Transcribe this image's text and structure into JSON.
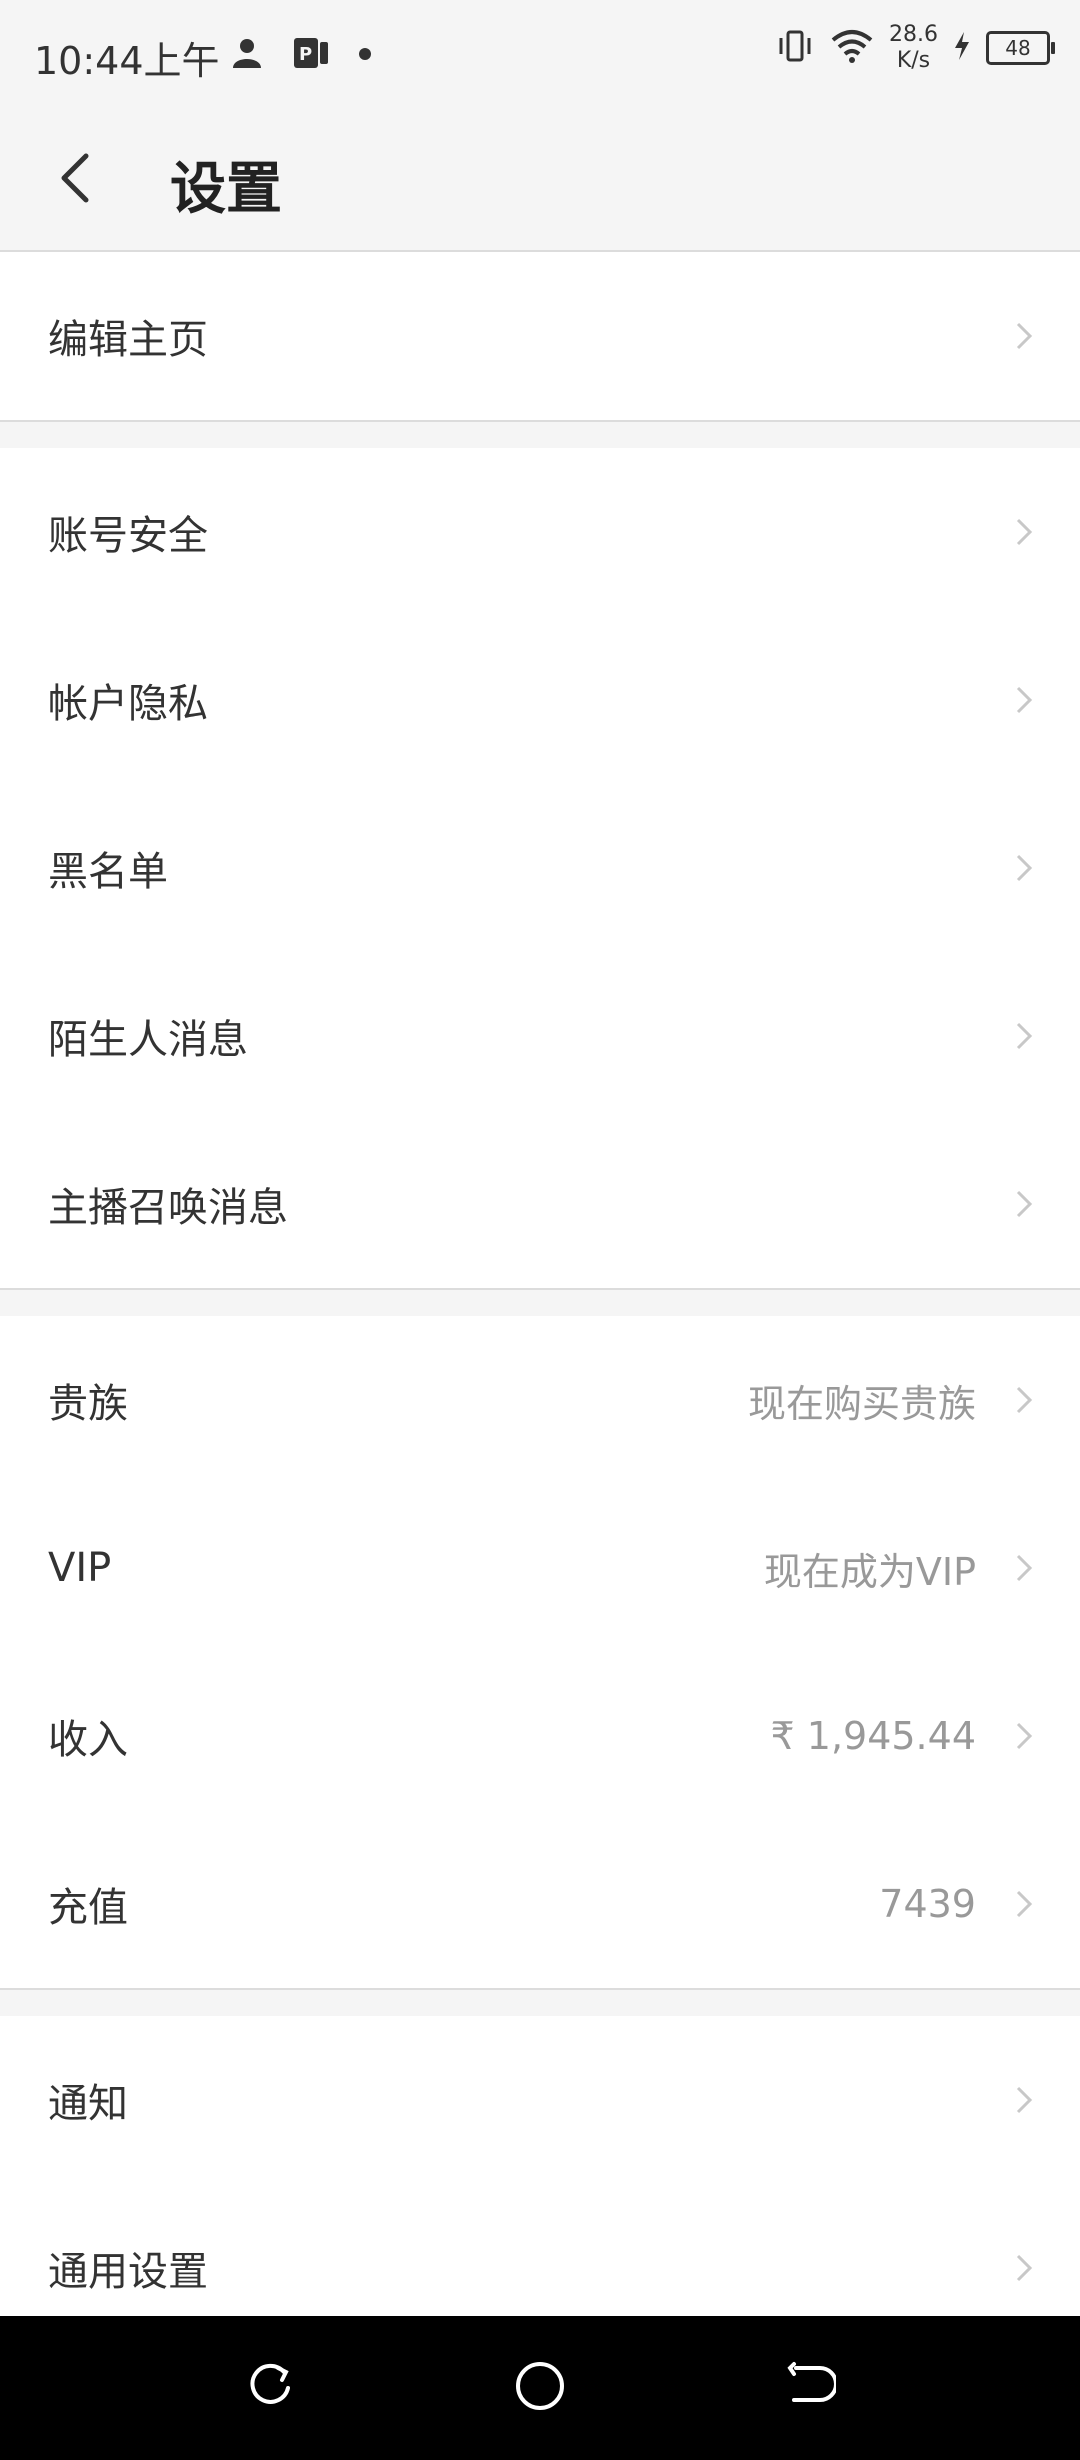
{
  "status_bar": {
    "time": "10:44上午",
    "speed_value": "28.6",
    "speed_unit": "K/s",
    "battery": "48",
    "icons": [
      "person-icon",
      "app-notification-icon",
      "dot-icon",
      "vibrate-icon",
      "wifi-icon",
      "charging-icon",
      "battery-icon"
    ]
  },
  "header": {
    "title": "设置",
    "back_icon": "chevron-left-icon"
  },
  "groups": [
    {
      "items": [
        {
          "label": "编辑主页",
          "value": ""
        }
      ]
    },
    {
      "items": [
        {
          "label": "账号安全",
          "value": ""
        },
        {
          "label": "帐户隐私",
          "value": ""
        },
        {
          "label": "黑名单",
          "value": ""
        },
        {
          "label": "陌生人消息",
          "value": ""
        },
        {
          "label": "主播召唤消息",
          "value": ""
        }
      ]
    },
    {
      "items": [
        {
          "label": "贵族",
          "value": "现在购买贵族"
        },
        {
          "label": "VIP",
          "value": "现在成为VIP"
        },
        {
          "label": "收入",
          "value": "₹ 1,945.44"
        },
        {
          "label": "充值",
          "value": "7439"
        }
      ]
    },
    {
      "items": [
        {
          "label": "通知",
          "value": ""
        },
        {
          "label": "通用设置",
          "value": ""
        }
      ]
    }
  ],
  "nav_bar": {
    "icons": [
      "recents-icon",
      "home-icon",
      "back-icon"
    ]
  },
  "colors": {
    "background": "#f5f5f5",
    "row_background": "#ffffff",
    "label_text": "#333333",
    "value_text": "#999999",
    "chevron": "#c8c8c8",
    "nav_bar": "#000000"
  }
}
